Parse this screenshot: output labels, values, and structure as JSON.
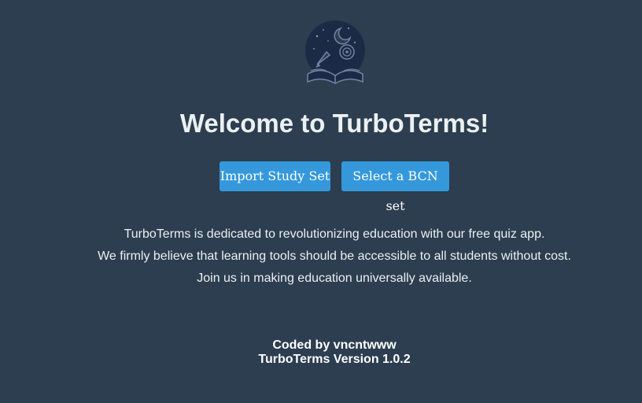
{
  "app": {
    "logo_icon": "rocket-moon-book-icon",
    "title": "Welcome to TurboTerms!"
  },
  "actions": {
    "import_label": "Import Study Set",
    "bcn_label": "Select a BCN set"
  },
  "about": {
    "lines": [
      "TurboTerms is dedicated to revolutionizing education with our free quiz app.",
      "We firmly believe that learning tools should be accessible to all students without cost.",
      "Join us in making education universally available."
    ]
  },
  "footer": {
    "credit": "Coded by vncntwww",
    "version": "TurboTerms Version 1.0.2"
  },
  "colors": {
    "background": "#2c3e50",
    "button": "#3498db",
    "text": "#ecf0f1"
  }
}
